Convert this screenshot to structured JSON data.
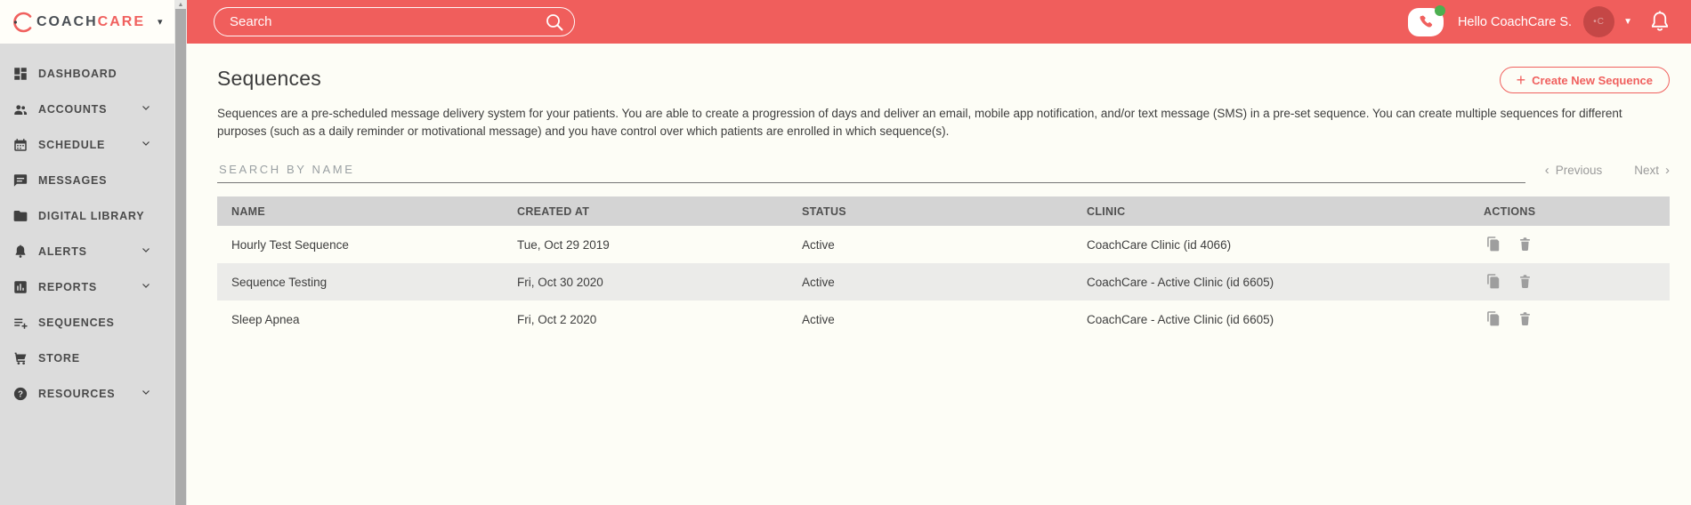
{
  "brand": {
    "logo_coach": "COACH",
    "logo_care": "CARE"
  },
  "header": {
    "search_placeholder": "Search",
    "greeting": "Hello CoachCare S."
  },
  "sidebar": {
    "items": [
      {
        "label": "DASHBOARD",
        "icon": "dashboard-icon",
        "has_chevron": false
      },
      {
        "label": "ACCOUNTS",
        "icon": "accounts-icon",
        "has_chevron": true
      },
      {
        "label": "SCHEDULE",
        "icon": "schedule-icon",
        "has_chevron": true
      },
      {
        "label": "MESSAGES",
        "icon": "messages-icon",
        "has_chevron": false
      },
      {
        "label": "DIGITAL LIBRARY",
        "icon": "digital-library-icon",
        "has_chevron": false
      },
      {
        "label": "ALERTS",
        "icon": "alerts-icon",
        "has_chevron": true
      },
      {
        "label": "REPORTS",
        "icon": "reports-icon",
        "has_chevron": true
      },
      {
        "label": "SEQUENCES",
        "icon": "sequences-icon",
        "has_chevron": false
      },
      {
        "label": "STORE",
        "icon": "store-icon",
        "has_chevron": false
      },
      {
        "label": "RESOURCES",
        "icon": "resources-icon",
        "has_chevron": true
      }
    ]
  },
  "page": {
    "title": "Sequences",
    "create_button": "Create New Sequence",
    "description": "Sequences are a pre-scheduled message delivery system for your patients. You are able to create a progression of days and deliver an email, mobile app notification, and/or text message (SMS) in a pre-set sequence. You can create multiple sequences for different purposes (such as a daily reminder or motivational message) and you have control over which patients are enrolled in which sequence(s)."
  },
  "filter": {
    "placeholder": "SEARCH BY NAME"
  },
  "pagination": {
    "previous": "Previous",
    "next": "Next"
  },
  "table": {
    "columns": [
      "NAME",
      "CREATED AT",
      "STATUS",
      "CLINIC",
      "ACTIONS"
    ],
    "rows": [
      {
        "name": "Hourly Test Sequence",
        "created_at": "Tue, Oct 29 2019",
        "status": "Active",
        "clinic": "CoachCare Clinic (id 4066)"
      },
      {
        "name": "Sequence Testing",
        "created_at": "Fri, Oct 30 2020",
        "status": "Active",
        "clinic": "CoachCare - Active Clinic (id 6605)"
      },
      {
        "name": "Sleep Apnea",
        "created_at": "Fri, Oct 2 2020",
        "status": "Active",
        "clinic": "CoachCare - Active Clinic (id 6605)"
      }
    ]
  },
  "colors": {
    "accent_red": "#f0605e",
    "topbar_red": "#f05e5c",
    "sidebar_bg": "#dcdcdc",
    "table_header_bg": "#d4d4d4",
    "row_alt_bg": "#ebebe9",
    "status_green": "#4caf50",
    "action_icon_gray": "#9e9e9e"
  }
}
